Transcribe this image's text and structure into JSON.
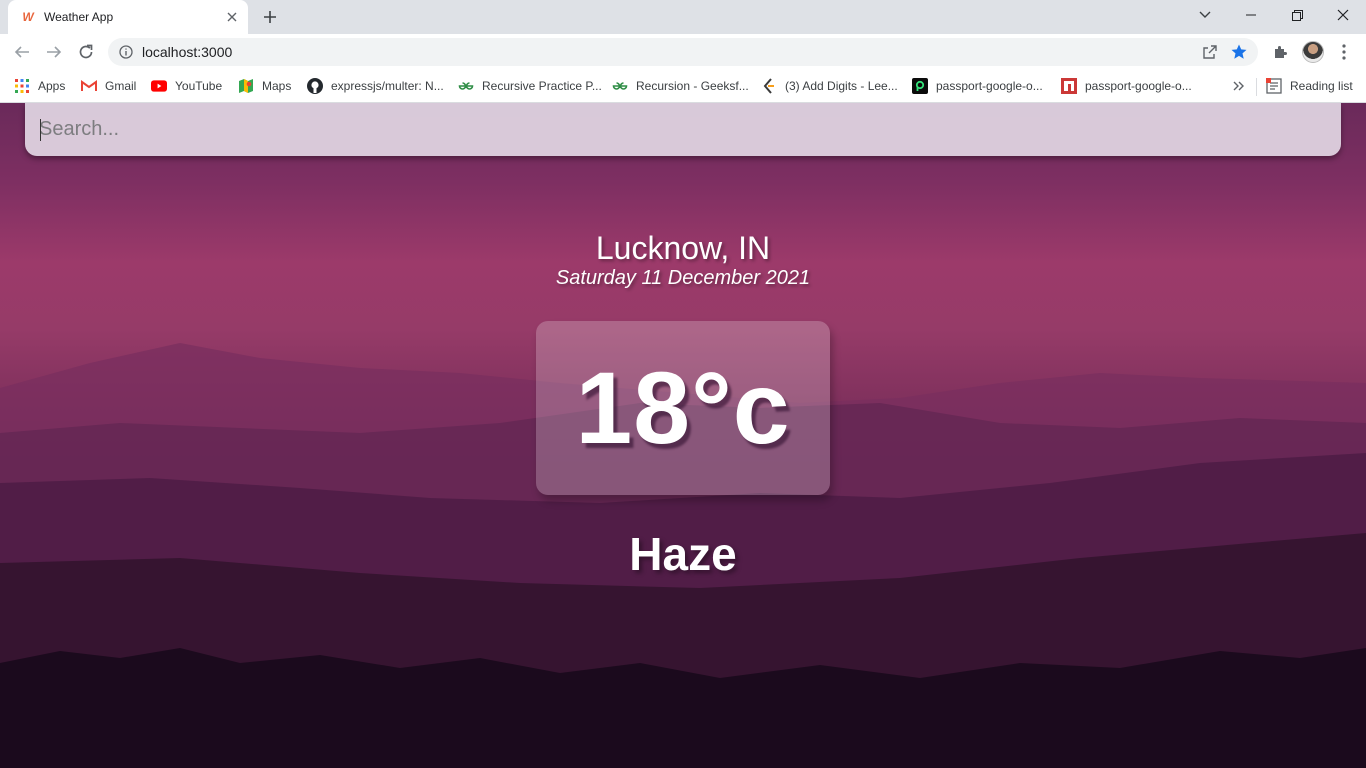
{
  "browser": {
    "tab": {
      "title": "Weather App",
      "favicon": "W"
    },
    "address": {
      "url": "localhost:3000"
    },
    "bookmarks": [
      {
        "label": "Apps",
        "icon": "apps-grid-icon"
      },
      {
        "label": "Gmail",
        "icon": "gmail-icon"
      },
      {
        "label": "YouTube",
        "icon": "youtube-icon"
      },
      {
        "label": "Maps",
        "icon": "maps-icon"
      },
      {
        "label": "expressjs/multer: N...",
        "icon": "github-icon"
      },
      {
        "label": "Recursive Practice P...",
        "icon": "geeksforgeeks-icon"
      },
      {
        "label": "Recursion - Geeksf...",
        "icon": "geeksforgeeks-icon"
      },
      {
        "label": "(3) Add Digits - Lee...",
        "icon": "leetcode-icon"
      },
      {
        "label": "passport-google-o...",
        "icon": "passport-icon"
      },
      {
        "label": "passport-google-o...",
        "icon": "npm-icon"
      }
    ],
    "reading_list": "Reading list",
    "colors": {
      "star": "#1a73e8",
      "youtube": "#ff0000",
      "gfg": "#2f8d46"
    }
  },
  "app": {
    "search": {
      "placeholder": "Search...",
      "value": ""
    },
    "location": "Lucknow, IN",
    "date": "Saturday 11 December 2021",
    "temperature": "18°c",
    "condition": "Haze"
  }
}
